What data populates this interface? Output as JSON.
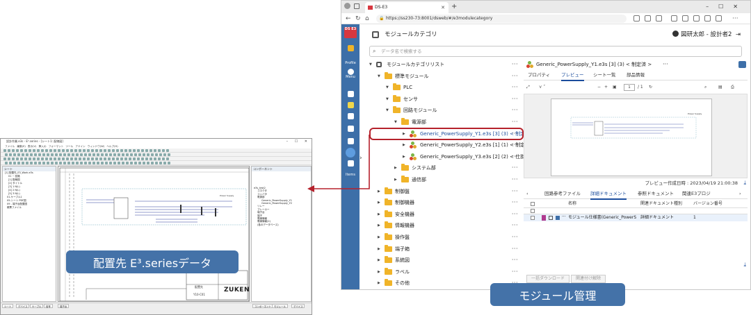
{
  "cad": {
    "title": "設計作業.e3s - E³.series - [シート1: 配線図]",
    "menu": "ファイル  編集(E)  表示(V)  挿入(I)  フォーマット  ツール  アドイン  ウィンドウ(W)  ヘルプ(H)",
    "tree_header": "シート",
    "tree_items": [
      "[1] 配置先_E3_Work.e3s",
      "01 ~ 回路",
      "[1] 配線図",
      "[2] タイトル",
      "[3] 1 N(L)",
      "[4] 2 N(L)",
      "[5] 3 N(L)",
      "01-ケーブル1",
      "05-シート PDF図",
      "09 - 端子台配置図",
      "帳票ファイル"
    ],
    "right_header": "コンポーネント",
    "right_items": [
      "e3s_test2",
      "コネクタ",
      "コンバタ",
      "電源部",
      "Generic_PowerSupply_Y1",
      "Generic_PowerSupply_Y2",
      "リレー",
      "ブレーカー",
      "端子台",
      "端子",
      "電線情報",
      "電線情報(2)",
      "(各のデータベース)"
    ],
    "sheet_text": [
      "Power Supply",
      "ZUKEN",
      "配置先",
      "Y10-C01"
    ],
    "bottom_tabs": [
      "シート",
      "デバイス",
      "ケーブル",
      "信号",
      "端子台"
    ],
    "bottom_right_tabs": [
      "コンポーネント",
      "モジュール",
      "デバイス"
    ]
  },
  "labels": {
    "left": "配置先 E³.seriesデータ",
    "right": "モジュール管理"
  },
  "browser": {
    "tab_title": "DS-E3",
    "url": "https://ss230-73:8001/dsweb/#/e3modulecategory",
    "sidebar": {
      "logo": "DS E3",
      "items": [
        "Profile",
        "Menu",
        "Items"
      ]
    },
    "header": {
      "title": "モジュールカテゴリ",
      "user": "図研太郎 - 設計者2"
    },
    "search_placeholder": "データ名で検索する",
    "tree": [
      {
        "label": "モジュールカテゴリリスト",
        "depth": 0,
        "icon": "cube"
      },
      {
        "label": "標準モジュール",
        "depth": 1,
        "icon": "folder"
      },
      {
        "label": "PLC",
        "depth": 2,
        "icon": "folder"
      },
      {
        "label": "センサ",
        "depth": 2,
        "icon": "folder"
      },
      {
        "label": "回路モジュール",
        "depth": 2,
        "icon": "folder"
      },
      {
        "label": "電源部",
        "depth": 3,
        "icon": "folder"
      },
      {
        "label": "Generic_PowerSupply_Y1.e3s [3] (3) < 制定...",
        "depth": 4,
        "icon": "module",
        "selected": true
      },
      {
        "label": "Generic_PowerSupply_Y2.e3s [1] (1) < 制定...",
        "depth": 4,
        "icon": "module"
      },
      {
        "label": "Generic_PowerSupply_Y3.e3s [2] (2) < 仕掛...",
        "depth": 4,
        "icon": "module"
      },
      {
        "label": "システム部",
        "depth": 3,
        "icon": "folder"
      },
      {
        "label": "通信部",
        "depth": 3,
        "icon": "folder"
      },
      {
        "label": "制御盤",
        "depth": 1,
        "icon": "folder"
      },
      {
        "label": "制御機器",
        "depth": 1,
        "icon": "folder"
      },
      {
        "label": "安全機器",
        "depth": 1,
        "icon": "folder"
      },
      {
        "label": "情報機器",
        "depth": 1,
        "icon": "folder"
      },
      {
        "label": "操作盤",
        "depth": 1,
        "icon": "folder"
      },
      {
        "label": "端子箱",
        "depth": 1,
        "icon": "folder"
      },
      {
        "label": "系統図",
        "depth": 1,
        "icon": "folder"
      },
      {
        "label": "ラベル",
        "depth": 1,
        "icon": "folder"
      },
      {
        "label": "その他",
        "depth": 1,
        "icon": "folder"
      }
    ],
    "detail": {
      "title": "Generic_PowerSupply_Y1.e3s [3] (3) < 制定済 >",
      "tabs": [
        "プロパティ",
        "プレビュー",
        "シート一覧",
        "部品情報"
      ],
      "active_tab": "プレビュー",
      "page_current": "1",
      "page_total": "/ 1",
      "preview_date": "プレビュー作成日時 : 2023/04/19 21:00:38",
      "bottom_tabs": [
        "回路参考ファイル",
        "詳細ドキュメント",
        "参照ドキュメント",
        "関連E3プロジ"
      ],
      "active_bottom_tab": "詳細ドキュメント",
      "grid_headers": [
        "名称",
        "関連ドキュメント種別",
        "バージョン番号"
      ],
      "grid_rows": [
        {
          "name": "モジュール仕様書(Generic_PowerS",
          "type": "詳細ドキュメント",
          "version": "1"
        }
      ],
      "footer_buttons": [
        "一括ダウンロード",
        "関連付け解除"
      ]
    }
  },
  "colors": {
    "accent": "#3d6fa8",
    "highlight": "#b5212b",
    "label_bg": "#4472a8",
    "folder": "#f0b429"
  }
}
